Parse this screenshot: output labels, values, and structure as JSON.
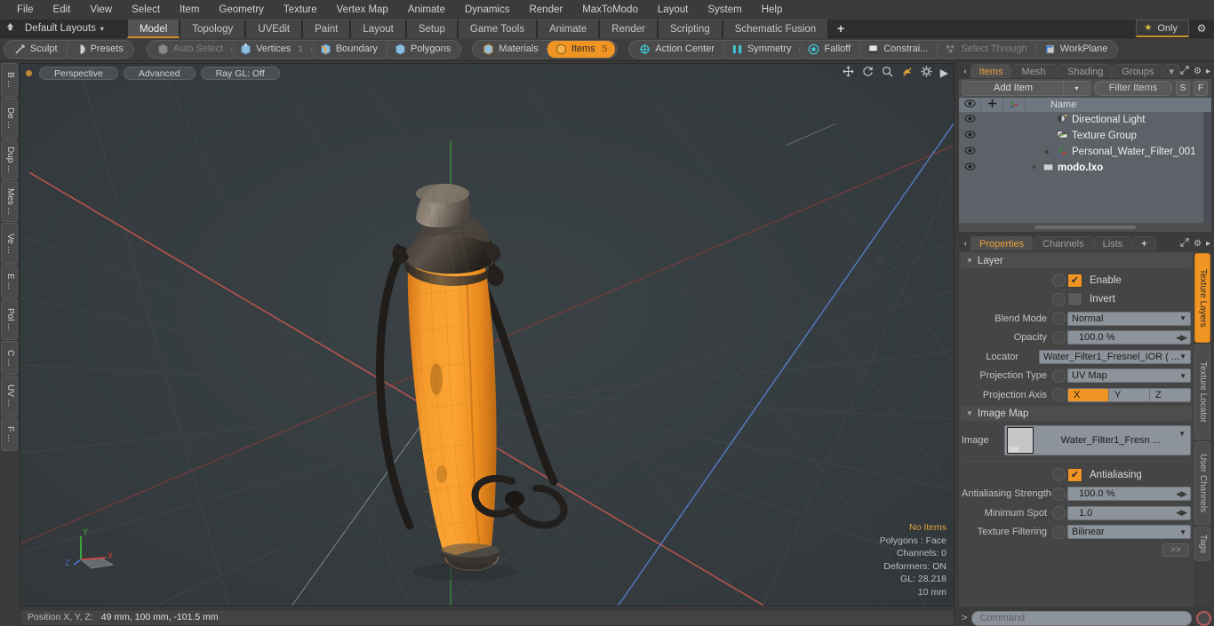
{
  "menubar": {
    "items": [
      "File",
      "Edit",
      "View",
      "Select",
      "Item",
      "Geometry",
      "Texture",
      "Vertex Map",
      "Animate",
      "Dynamics",
      "Render",
      "MaxToModo",
      "Layout",
      "System",
      "Help"
    ]
  },
  "layoutbar": {
    "home_icon": "home-icon",
    "layout_select": "Default Layouts",
    "caret": "▾",
    "tabs": [
      {
        "label": "Model",
        "active": true
      },
      {
        "label": "Topology",
        "active": false
      },
      {
        "label": "UVEdit",
        "active": false
      },
      {
        "label": "Paint",
        "active": false
      },
      {
        "label": "Layout",
        "active": false
      },
      {
        "label": "Setup",
        "active": false
      },
      {
        "label": "Game Tools",
        "active": false
      },
      {
        "label": "Animate",
        "active": false
      },
      {
        "label": "Render",
        "active": false
      },
      {
        "label": "Scripting",
        "active": false
      },
      {
        "label": "Schematic Fusion",
        "active": false
      }
    ],
    "add_tab": "+",
    "only_label": "Only",
    "only_star": "★",
    "gear": "⚙"
  },
  "modebar": {
    "left_group": [
      {
        "label": "Sculpt",
        "icon": "sculpt-icon",
        "dim": false,
        "selected": false,
        "num": ""
      },
      {
        "label": "Presets",
        "icon": "presets-icon",
        "dim": false,
        "selected": false,
        "num": ""
      }
    ],
    "select_group": [
      {
        "label": "Auto Select",
        "icon": "cube-icon",
        "dim": true,
        "selected": false,
        "num": ""
      },
      {
        "label": "Vertices",
        "icon": "vertices-icon",
        "dim": false,
        "selected": false,
        "num": "1"
      },
      {
        "label": "Boundary",
        "icon": "boundary-icon",
        "dim": false,
        "selected": false,
        "num": ""
      },
      {
        "label": "Polygons",
        "icon": "polygons-icon",
        "dim": false,
        "selected": false,
        "num": ""
      }
    ],
    "item_group": [
      {
        "label": "Materials",
        "icon": "materials-icon",
        "dim": false,
        "selected": false,
        "num": ""
      },
      {
        "label": "Items",
        "icon": "items-icon",
        "dim": false,
        "selected": true,
        "num": "5"
      }
    ],
    "tool_group": [
      {
        "label": "Action Center",
        "icon": "action-center-icon",
        "dim": false,
        "selected": false,
        "num": ""
      },
      {
        "label": "Symmetry",
        "icon": "symmetry-icon",
        "dim": false,
        "selected": false,
        "num": ""
      },
      {
        "label": "Falloff",
        "icon": "falloff-icon",
        "dim": false,
        "selected": false,
        "num": ""
      },
      {
        "label": "Constrai...",
        "icon": "constraint-icon",
        "dim": false,
        "selected": false,
        "num": ""
      },
      {
        "label": "Select Through",
        "icon": "select-through-icon",
        "dim": true,
        "selected": false,
        "num": ""
      },
      {
        "label": "WorkPlane",
        "icon": "workplane-icon",
        "dim": false,
        "selected": false,
        "num": ""
      }
    ]
  },
  "left_strip": {
    "tabs": [
      "B ...",
      "De ...",
      "Dup ...",
      "Mes ...",
      "Ve ...",
      "E ...",
      "Pol ...",
      "C ...",
      "UV ...",
      "F ..."
    ]
  },
  "viewport": {
    "view_mode": "Perspective",
    "shading": "Advanced",
    "raygl": "Ray GL: Off",
    "icons": [
      "move-icon",
      "rotate-icon",
      "zoom-icon",
      "fit-icon",
      "gear-icon",
      "arrow-icon"
    ],
    "axis_gizmo": {
      "x": "X",
      "y": "Y",
      "z": "Z"
    },
    "stats": {
      "selection": "No Items",
      "polygons": "Polygons : Face",
      "channels": "Channels: 0",
      "deformers": "Deformers: ON",
      "gl": "GL: 28,218",
      "scale": "10 mm"
    }
  },
  "statusbar": {
    "position_label": "Position X, Y, Z:",
    "position_value": "49 mm, 100 mm, -101.5 mm"
  },
  "items_panel": {
    "tabs": [
      {
        "label": "Items",
        "active": true
      },
      {
        "label": "Mesh ...",
        "active": false
      },
      {
        "label": "Shading",
        "active": false
      },
      {
        "label": "Groups",
        "active": false
      }
    ],
    "tab_more": "▾",
    "expand_icon": "expand-icon",
    "gear_icon": "⚙",
    "arrow_icon": "▸",
    "add_item": "Add Item",
    "add_item_caret": "▾",
    "filter_items": "Filter Items",
    "btn_s": "S",
    "btn_f": "F",
    "columns": {
      "eye": "eye-icon",
      "lock": "move-lock-icon",
      "axis": "axis-icon",
      "name": "Name"
    },
    "rows": [
      {
        "name": "modo.lxo",
        "icon": "scene-icon",
        "indent": 0,
        "bold": true,
        "twisty": "▼"
      },
      {
        "name": "Personal_Water_Filter_001",
        "icon": "mesh-axis-icon",
        "indent": 1,
        "bold": false,
        "twisty": "▶"
      },
      {
        "name": "Texture Group",
        "icon": "texture-group-icon",
        "indent": 1,
        "bold": false,
        "twisty": ""
      },
      {
        "name": "Directional Light",
        "icon": "light-icon",
        "indent": 1,
        "bold": false,
        "twisty": ""
      }
    ]
  },
  "properties_panel": {
    "tabs": [
      {
        "label": "Properties",
        "active": true
      },
      {
        "label": "Channels",
        "active": false
      },
      {
        "label": "Lists",
        "active": false
      },
      {
        "label": "+",
        "active": false
      }
    ],
    "sections": {
      "layer": {
        "title": "Layer",
        "enable": {
          "label": "Enable",
          "checked": true
        },
        "invert": {
          "label": "Invert",
          "checked": false
        },
        "blend_mode": {
          "label": "Blend Mode",
          "value": "Normal"
        },
        "opacity": {
          "label": "Opacity",
          "value": "100.0 %"
        },
        "locator": {
          "label": "Locator",
          "value": "Water_Filter1_Fresnel_IOR ( ..."
        },
        "projection_type": {
          "label": "Projection Type",
          "value": "UV Map"
        },
        "projection_axis": {
          "label": "Projection Axis",
          "options": [
            "X",
            "Y",
            "Z"
          ],
          "selected": "X"
        }
      },
      "image_map": {
        "title": "Image Map",
        "image": {
          "label": "Image",
          "value": "Water_Filter1_Fresn ..."
        },
        "antialiasing": {
          "label": "Antialiasing",
          "checked": true
        },
        "antialiasing_strength": {
          "label": "Antialiasing Strength",
          "value": "100.0 %"
        },
        "minimum_spot": {
          "label": "Minimum Spot",
          "value": "1.0"
        },
        "texture_filtering": {
          "label": "Texture Filtering",
          "value": "Bilinear"
        },
        "more_button": ">>"
      }
    }
  },
  "right_strip": {
    "tabs": [
      {
        "label": "Texture Layers",
        "active": true
      },
      {
        "label": "Texture Locator",
        "active": false
      },
      {
        "label": "User Channels",
        "active": false
      },
      {
        "label": "Tags",
        "active": false
      }
    ]
  },
  "command_bar": {
    "prompt": ">",
    "placeholder": "Command",
    "record_icon": "record-icon"
  },
  "colors": {
    "accent": "#f09423",
    "panel": "#3b3b3b",
    "viewport_bg": "#343a3d",
    "tree_bg": "#5d6168",
    "field_bg": "#8d939a",
    "axis_x": "#d05050",
    "axis_y": "#44bb44",
    "axis_z": "#5a7fd0",
    "object_orange": "#f59a2a",
    "object_dark": "#2e2b29"
  }
}
